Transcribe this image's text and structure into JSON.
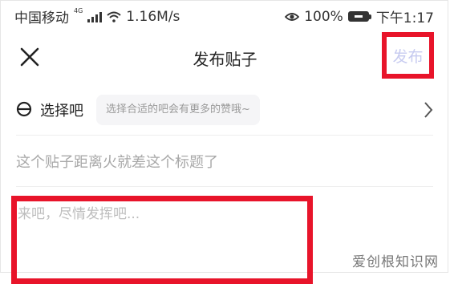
{
  "status_bar": {
    "carrier": "中国移动",
    "network": "4G",
    "speed": "1.16M/s",
    "battery": "100%",
    "time": "下午1:17"
  },
  "header": {
    "title": "发布贴子",
    "publish_label": "发布"
  },
  "forum": {
    "label": "选择吧",
    "hint": "选择合适的吧会有更多的赞哦~"
  },
  "post": {
    "title_placeholder": "这个贴子距离火就差这个标题了",
    "body_placeholder": "来吧，尽情发挥吧..."
  },
  "watermark": "爱创根知识网",
  "colors": {
    "highlight": "#e8142a",
    "publish_disabled": "#c7cbf0"
  }
}
